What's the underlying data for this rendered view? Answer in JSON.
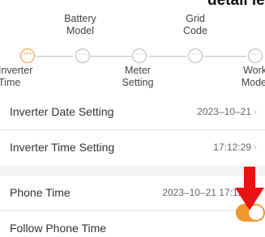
{
  "header": {
    "title_fragment": "detail level"
  },
  "stepper": {
    "steps": [
      {
        "label": "Inverter\nTime",
        "position": "bottom",
        "active": true
      },
      {
        "label": "Battery\nModel",
        "position": "top",
        "active": false
      },
      {
        "label": "Meter\nSetting",
        "position": "bottom",
        "active": false
      },
      {
        "label": "Grid\nCode",
        "position": "top",
        "active": false
      },
      {
        "label": "Work\nMode",
        "position": "bottom",
        "active": false
      }
    ],
    "node_glyph": "···"
  },
  "settings": {
    "inverter_date": {
      "label": "Inverter Date Setting",
      "value": "2023–10–21"
    },
    "inverter_time": {
      "label": "Inverter Time Setting",
      "value": "17:12:29"
    },
    "phone_time": {
      "label": "Phone Time",
      "value": "2023–10–21 17:12:32"
    },
    "follow_phone_time": {
      "label": "Follow Phone Time",
      "enabled": true
    }
  },
  "colors": {
    "accent": "#f0962f",
    "annotation_arrow": "#e81313",
    "inactive_node": "#b8b8b8"
  },
  "icons": {
    "chevron": "chevron-right-icon",
    "annotation": "red-down-arrow-icon"
  }
}
